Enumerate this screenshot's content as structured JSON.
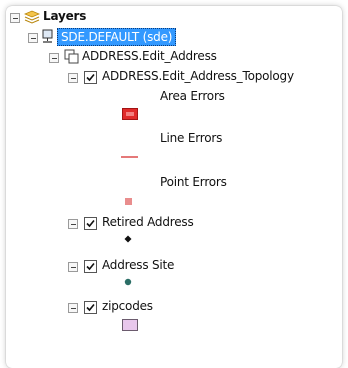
{
  "tree": {
    "root_label": "Layers",
    "db_label": "SDE.DEFAULT (sde)",
    "group_label": "ADDRESS.Edit_Address",
    "topology_label": "ADDRESS.Edit_Address_Topology",
    "topology_items": {
      "area_errors": "Area Errors",
      "line_errors": "Line Errors",
      "point_errors": "Point Errors"
    },
    "retired_label": "Retired Address",
    "site_label": "Address Site",
    "zipcodes_label": "zipcodes"
  },
  "icons": {
    "root": "layers-icon",
    "db": "database-icon",
    "group": "group-layer-icon",
    "area": "area-error-symbol",
    "line": "line-error-symbol",
    "point": "point-error-symbol",
    "retired": "black-point-symbol",
    "site": "teal-point-symbol",
    "zip": "polygon-symbol"
  },
  "colors": {
    "selection": "#3399ff",
    "area_error": "#e02a2a",
    "line_error": "#e57979",
    "point_error": "#e98d8d",
    "address_site": "#2b6e66",
    "zip_fill": "#e8c7ec"
  }
}
